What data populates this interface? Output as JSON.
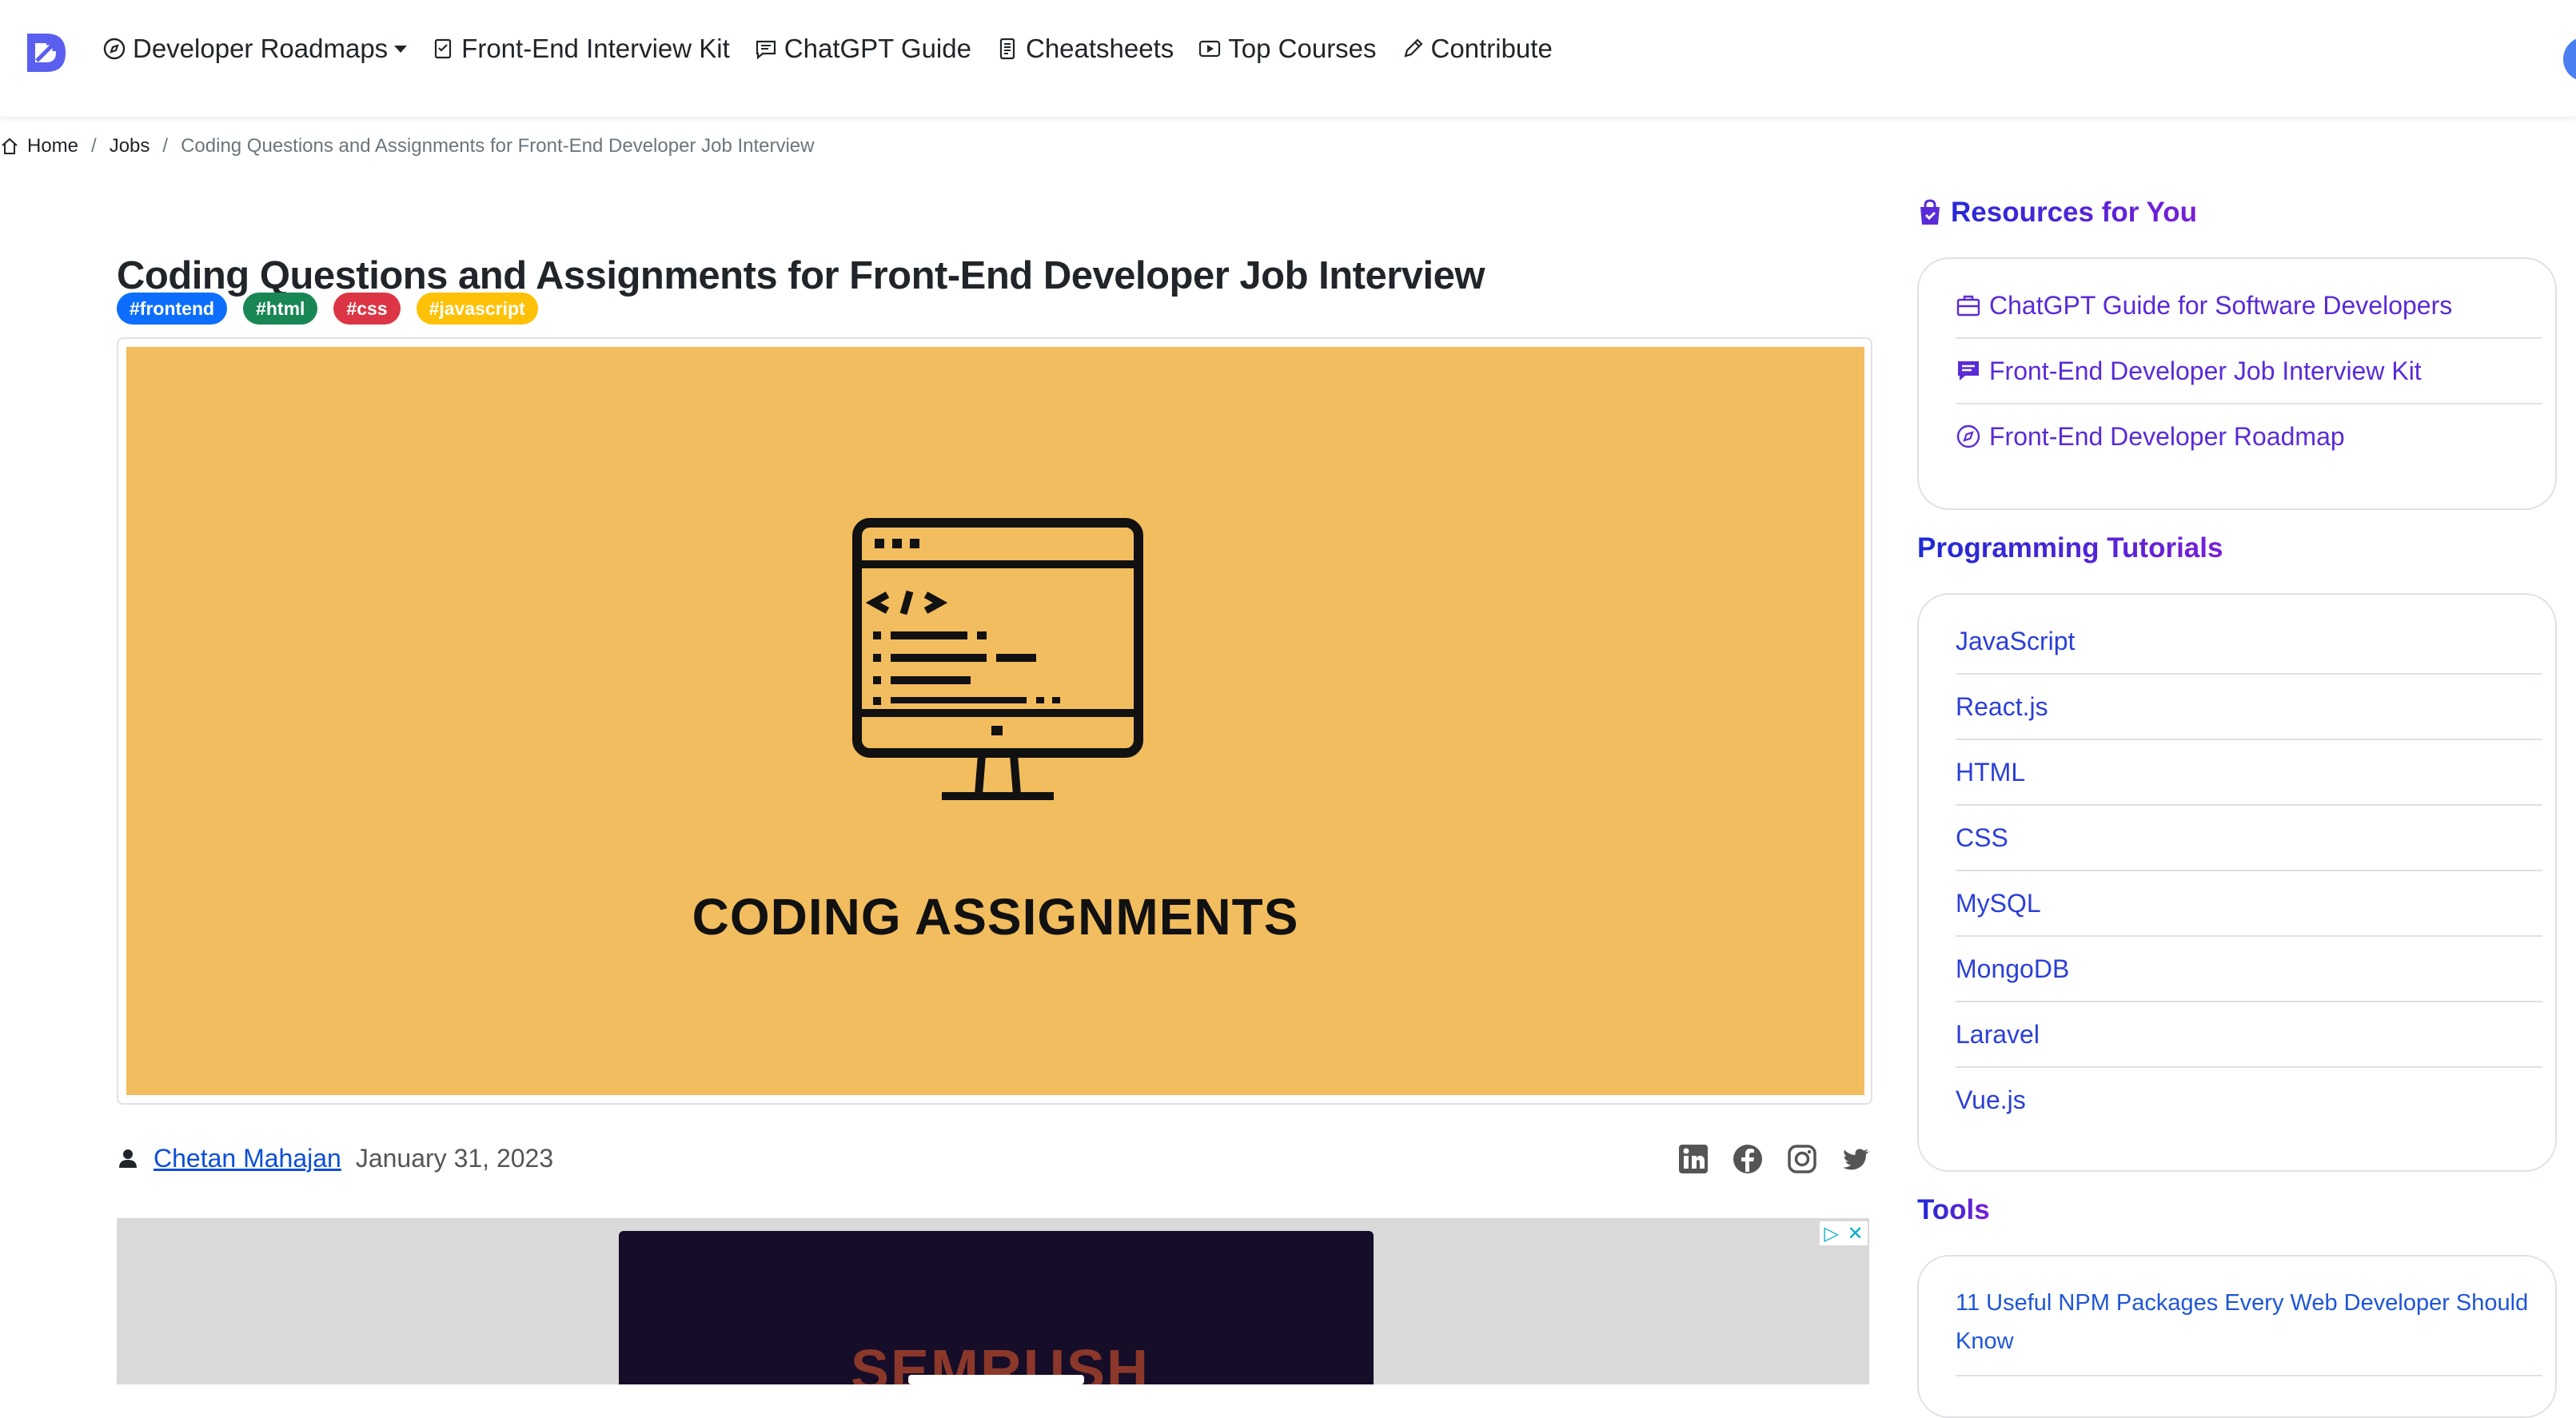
{
  "nav": {
    "items": [
      {
        "label": "Developer Roadmaps",
        "icon": "compass-icon",
        "has_caret": true
      },
      {
        "label": "Front-End Interview Kit",
        "icon": "checklist-icon"
      },
      {
        "label": "ChatGPT Guide",
        "icon": "chat-icon"
      },
      {
        "label": "Cheatsheets",
        "icon": "document-icon"
      },
      {
        "label": "Top Courses",
        "icon": "play-icon"
      },
      {
        "label": "Contribute",
        "icon": "pencil-icon"
      }
    ]
  },
  "breadcrumb": {
    "home": "Home",
    "jobs": "Jobs",
    "current": "Coding Questions and Assignments for Front-End Developer Job Interview",
    "separator": "/"
  },
  "article": {
    "title": "Coding Questions and Assignments for Front-End Developer Job Interview",
    "tags": [
      {
        "label": "#frontend",
        "color": "#0d6efd"
      },
      {
        "label": "#html",
        "color": "#198754"
      },
      {
        "label": "#css",
        "color": "#dc3545"
      },
      {
        "label": "#javascript",
        "color": "#ffc107"
      }
    ],
    "feature_image": {
      "caption": "CODING ASSIGNMENTS",
      "background": "#f2bd5e"
    },
    "author": "Chetan Mahajan",
    "date": "January 31, 2023",
    "social": [
      "linkedin-icon",
      "facebook-icon",
      "instagram-icon",
      "twitter-icon"
    ]
  },
  "ad": {
    "brand": "SEMRUSH"
  },
  "sidebar": {
    "resources_heading": "Resources for You",
    "resources": [
      {
        "label": "ChatGPT Guide for Software Developers",
        "icon": "briefcase-icon"
      },
      {
        "label": "Front-End Developer Job Interview Kit",
        "icon": "chat-icon"
      },
      {
        "label": "Front-End Developer Roadmap",
        "icon": "compass-icon"
      }
    ],
    "tutorials_heading": "Programming Tutorials",
    "tutorials": [
      "JavaScript",
      "React.js",
      "HTML",
      "CSS",
      "MySQL",
      "MongoDB",
      "Laravel",
      "Vue.js"
    ],
    "tools_heading": "Tools",
    "tools": [
      "11 Useful NPM Packages Every Web Developer Should Know"
    ]
  },
  "colors": {
    "link": "#0d4fd6",
    "heading_gradient_start": "#1b2bd6",
    "heading_gradient_end": "#7b1fd6"
  }
}
